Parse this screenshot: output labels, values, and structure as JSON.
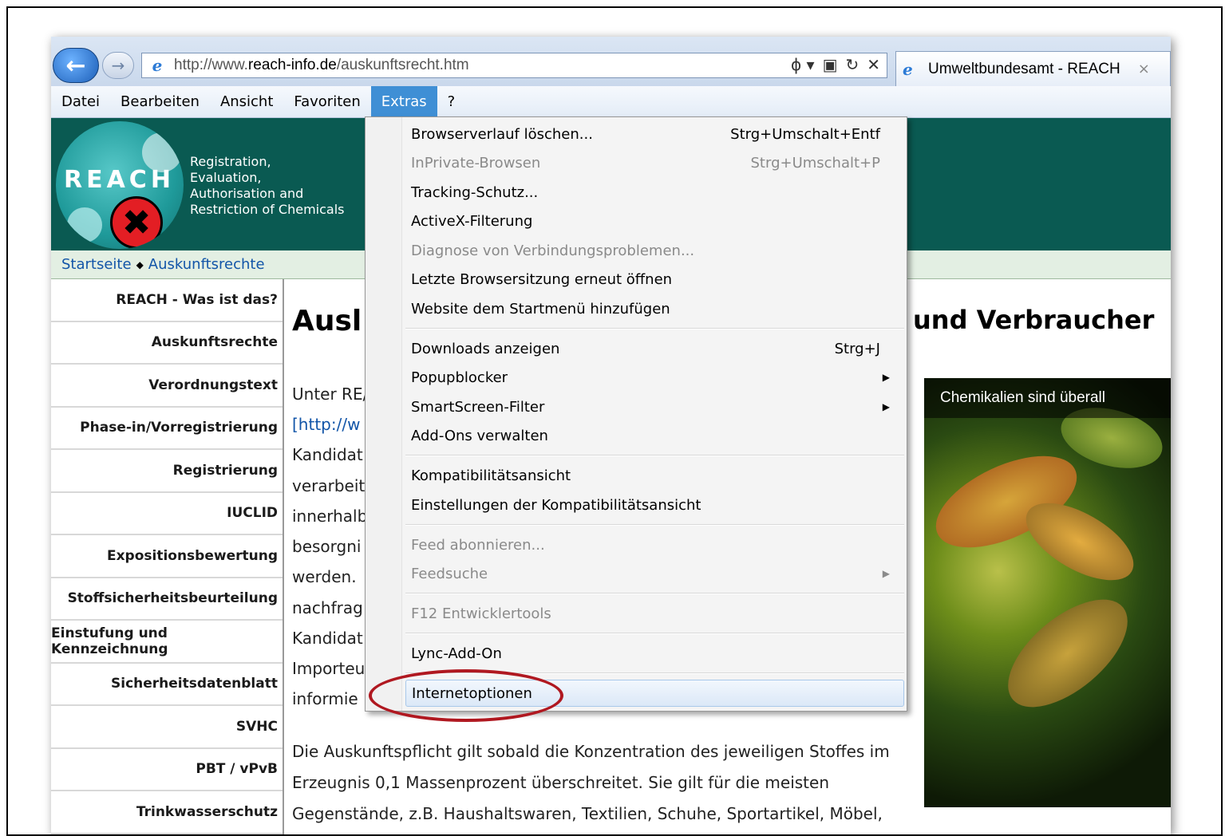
{
  "browser": {
    "url_prefix": "http://www.",
    "url_domain": "reach-info.de",
    "url_path": "/auskunftsrecht.htm",
    "tab_title": "Umweltbundesamt - REACH",
    "tab_close": "×",
    "addr_tools": [
      "ϕ ▾",
      "▣",
      "↻",
      "✕"
    ],
    "back_label": "←",
    "forward_label": "→",
    "ie_icon": "e"
  },
  "menubar": {
    "items": [
      "Datei",
      "Bearbeiten",
      "Ansicht",
      "Favoriten",
      "Extras",
      "?"
    ],
    "active": "Extras"
  },
  "header": {
    "logo_text": "REACH",
    "logo_mark": "✖",
    "sub_lines": [
      "Registration,",
      "Evaluation,",
      "Authorisation and",
      "Restriction of Chemicals"
    ]
  },
  "breadcrumb": {
    "items": [
      "Startseite",
      "Auskunftsrechte"
    ],
    "separator": "◆"
  },
  "sidebar": {
    "items": [
      "REACH - Was ist das?",
      "Auskunftsrechte",
      "Verordnungstext",
      "Phase-in/Vorregistrierung",
      "Registrierung",
      "IUCLID",
      "Expositionsbewertung",
      "Stoffsicherheitsbeurteilung",
      "Einstufung und Kennzeichnung",
      "Sicherheitsdatenblatt",
      "SVHC",
      "PBT / vPvB",
      "Trinkwasserschutz"
    ]
  },
  "main": {
    "title_left": "Ausl",
    "title_right": "und Verbraucher",
    "para1": [
      "Unter RE/",
      "[http://w",
      "Kandidat",
      "verarbeit",
      "innerhalb",
      "besorgni",
      "werden.",
      "nachfrag",
      "Kandidat",
      "Importeu",
      "informie"
    ],
    "para2": [
      "Die Auskunftspflicht gilt sobald die Konzentration des jeweiligen Stoffes im",
      "Erzeugnis 0,1 Massenprozent überschreitet. Sie gilt für die meisten",
      "Gegenstände, z.B. Haushaltswaren, Textilien, Schuhe, Sportartikel, Möbel,"
    ],
    "image_caption": "Chemikalien sind überall"
  },
  "dropdown": {
    "items": [
      {
        "label": "Browserverlauf löschen...",
        "shortcut": "Strg+Umschalt+Entf",
        "disabled": false
      },
      {
        "label": "InPrivate-Browsen",
        "shortcut": "Strg+Umschalt+P",
        "disabled": true
      },
      {
        "label": "Tracking-Schutz...",
        "disabled": false
      },
      {
        "label": "ActiveX-Filterung",
        "disabled": false
      },
      {
        "label": "Diagnose von Verbindungsproblemen...",
        "disabled": true
      },
      {
        "label": "Letzte Browsersitzung erneut öffnen",
        "disabled": false
      },
      {
        "label": "Website dem Startmenü hinzufügen",
        "disabled": false
      },
      {
        "label": "Downloads anzeigen",
        "shortcut": "Strg+J",
        "disabled": false
      },
      {
        "label": "Popupblocker",
        "submenu": true,
        "disabled": false
      },
      {
        "label": "SmartScreen-Filter",
        "submenu": true,
        "disabled": false
      },
      {
        "label": "Add-Ons verwalten",
        "disabled": false
      },
      {
        "label": "Kompatibilitätsansicht",
        "disabled": false
      },
      {
        "label": "Einstellungen der Kompatibilitätsansicht",
        "disabled": false
      },
      {
        "label": "Feed abonnieren...",
        "disabled": true
      },
      {
        "label": "Feedsuche",
        "submenu": true,
        "disabled": true
      },
      {
        "label": "F12 Entwicklertools",
        "disabled": true
      },
      {
        "label": "Lync-Add-On",
        "disabled": false
      },
      {
        "label": "Internetoptionen",
        "disabled": false,
        "highlighted": true
      }
    ],
    "submenu_arrow": "▶"
  },
  "colors": {
    "header_bg": "#0a5a52",
    "menu_active": "#3f8fd5",
    "annotation": "#b01820"
  }
}
